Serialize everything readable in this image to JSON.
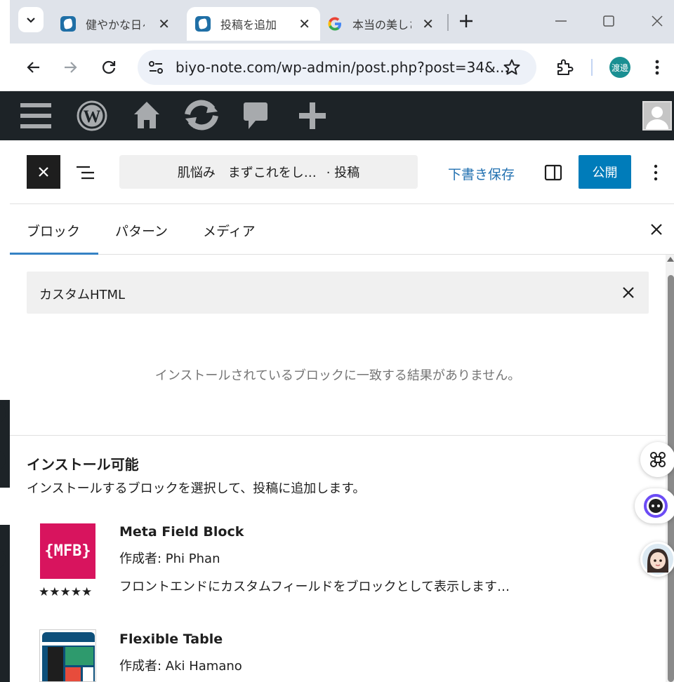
{
  "browser": {
    "tabs": [
      {
        "title": "健やかな日々"
      },
      {
        "title": "投稿を追加"
      },
      {
        "title": "本当の美しさ"
      }
    ],
    "url": "biyo-note.com/wp-admin/post.php?post=34&...",
    "profile_initials": "渡邊"
  },
  "editor": {
    "document_title": "肌悩み　まずこれをし…",
    "document_type": "· 投稿",
    "save_draft_label": "下書き保存",
    "publish_label": "公開"
  },
  "inserter": {
    "tabs": [
      "ブロック",
      "パターン",
      "メディア"
    ],
    "active_tab": "ブロック",
    "search_value": "カスタムHTML",
    "no_results": "インストールされているブロックに一致する結果がありません。",
    "installable_title": "インストール可能",
    "installable_desc": "インストールするブロックを選択して、投稿に追加します。",
    "items": [
      {
        "icon_text": "{MFB}",
        "name": "Meta Field Block",
        "author": "作成者: Phi Phan",
        "rating": "★★★★★",
        "description": "フロントエンドにカスタムフィールドをブロックとして表示します…"
      },
      {
        "name": "Flexible Table",
        "author": "作成者: Aki Hamano"
      }
    ]
  },
  "colors": {
    "admin_bar": "#1d2327",
    "publish": "#007cba",
    "link": "#2271b1",
    "mfb_icon": "#d8145e"
  }
}
